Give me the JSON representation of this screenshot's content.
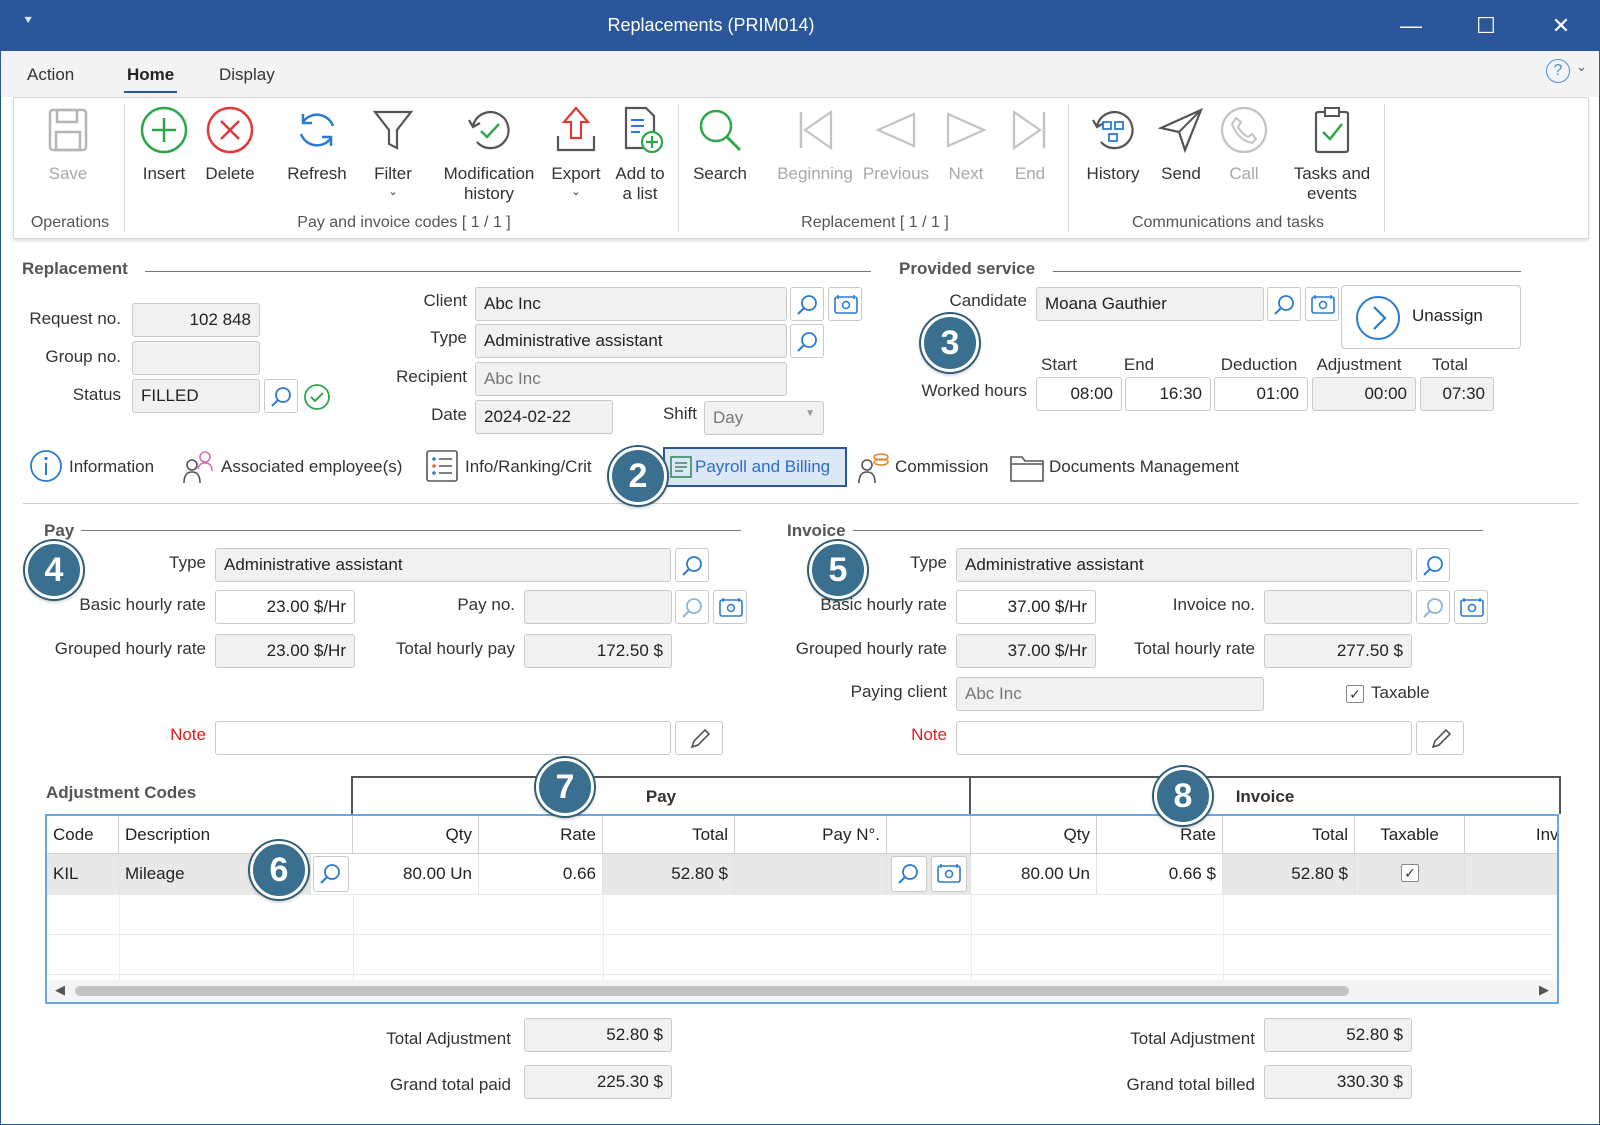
{
  "window": {
    "title": "Replacements (PRIM014)",
    "quick_access": "⯆",
    "minimize": "—",
    "maximize": "☐",
    "close": "✕"
  },
  "menu": {
    "tabs": [
      "Action",
      "Home",
      "Display"
    ],
    "active": "Home",
    "help": "?",
    "help_chevron": "⌄"
  },
  "ribbon": {
    "save": "Save",
    "insert": "Insert",
    "delete": "Delete",
    "refresh": "Refresh",
    "filter": "Filter",
    "modification_history_1": "Modification",
    "modification_history_2": "history",
    "export": "Export",
    "add_list_1": "Add to",
    "add_list_2": "a list",
    "search": "Search",
    "beginning": "Beginning",
    "previous": "Previous",
    "next": "Next",
    "end": "End",
    "history": "History",
    "send": "Send",
    "call": "Call",
    "tasks_1": "Tasks and",
    "tasks_2": "events",
    "chevron": "⌄",
    "groups": {
      "operations": "Operations",
      "codes": "Pay and invoice codes [ 1 / 1 ]",
      "replacement": "Replacement [ 1 / 1 ]",
      "comms": "Communications and tasks"
    }
  },
  "replacement": {
    "section": "Replacement",
    "request_no_label": "Request no.",
    "request_no": "102 848",
    "group_no_label": "Group no.",
    "group_no": "",
    "status_label": "Status",
    "status": "FILLED",
    "client_label": "Client",
    "client": "Abc Inc",
    "type_label": "Type",
    "type": "Administrative assistant",
    "recipient_label": "Recipient",
    "recipient": "Abc Inc",
    "date_label": "Date",
    "date": "2024-02-22",
    "shift_label": "Shift",
    "shift": "Day"
  },
  "provided_service": {
    "section": "Provided service",
    "candidate_label": "Candidate",
    "candidate": "Moana Gauthier",
    "unassign": "Unassign",
    "worked_hours_label": "Worked hours",
    "start_label": "Start",
    "start": "08:00",
    "end_label": "End",
    "end": "16:30",
    "deduction_label": "Deduction",
    "deduction": "01:00",
    "adjustment_label": "Adjustment",
    "adjustment": "00:00",
    "total_label": "Total",
    "total": "07:30"
  },
  "tabs": [
    "Information",
    "Associated employee(s)",
    "Info/Ranking/Crit",
    "Payroll and Billing",
    "Commission",
    "Documents Management"
  ],
  "pay": {
    "section": "Pay",
    "type_label": "Type",
    "type": "Administrative assistant",
    "basic_rate_label": "Basic hourly rate",
    "basic_rate": "23.00 $/Hr",
    "pay_no_label": "Pay no.",
    "pay_no": "",
    "grouped_rate_label": "Grouped hourly rate",
    "grouped_rate": "23.00 $/Hr",
    "total_pay_label": "Total hourly pay",
    "total_pay": "172.50 $",
    "note_label": "Note",
    "note": ""
  },
  "invoice": {
    "section": "Invoice",
    "type_label": "Type",
    "type": "Administrative assistant",
    "basic_rate_label": "Basic hourly rate",
    "basic_rate": "37.00 $/Hr",
    "invoice_no_label": "Invoice no.",
    "invoice_no": "",
    "grouped_rate_label": "Grouped hourly rate",
    "grouped_rate": "37.00 $/Hr",
    "total_rate_label": "Total hourly rate",
    "total_rate": "277.50 $",
    "paying_client_label": "Paying client",
    "paying_client": "Abc Inc",
    "taxable_label": "Taxable",
    "note_label": "Note",
    "note": ""
  },
  "adjustments": {
    "section": "Adjustment Codes",
    "band_pay": "Pay",
    "band_invoice": "Invoice",
    "headers": {
      "code": "Code",
      "description": "Description",
      "qty": "Qty",
      "rate": "Rate",
      "total": "Total",
      "pay_no": "Pay N°.",
      "inv_qty": "Qty",
      "inv_rate": "Rate",
      "inv_total": "Total",
      "taxable": "Taxable",
      "invo": "Invo"
    },
    "rows": [
      {
        "code": "KIL",
        "description": "Mileage",
        "qty": "80.00 Un",
        "rate": "0.66",
        "total": "52.80 $",
        "pay_no": "",
        "inv_qty": "80.00 Un",
        "inv_rate": "0.66 $",
        "inv_total": "52.80 $",
        "taxable": "✓"
      }
    ],
    "scroll_left": "◀",
    "scroll_right": "▶"
  },
  "totals": {
    "pay_total_adjustment_label": "Total Adjustment",
    "pay_total_adjustment": "52.80 $",
    "grand_total_paid_label": "Grand total paid",
    "grand_total_paid": "225.30 $",
    "inv_total_adjustment_label": "Total Adjustment",
    "inv_total_adjustment": "52.80 $",
    "grand_total_billed_label": "Grand total billed",
    "grand_total_billed": "330.30 $"
  },
  "badges": [
    "2",
    "3",
    "4",
    "5",
    "6",
    "7",
    "8"
  ],
  "colors": {
    "accent": "#2b579a",
    "badge": "#3a6f8f",
    "insert": "#2ea84a",
    "delete": "#e03a3a",
    "link": "#2b7bd0"
  }
}
